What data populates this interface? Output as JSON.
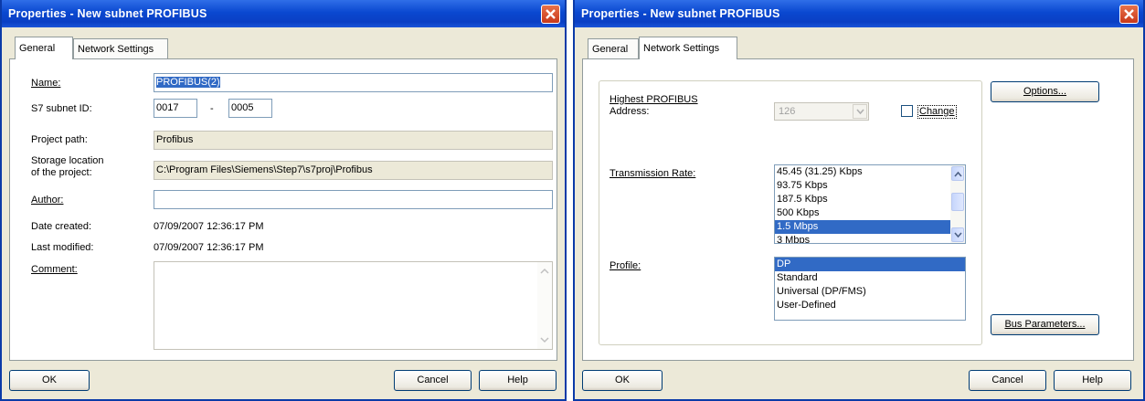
{
  "left_window": {
    "title": "Properties -  New subnet PROFIBUS",
    "tabs": [
      "General",
      "Network Settings"
    ],
    "labels": {
      "name": "Name:",
      "subnet_id": "S7 subnet ID:",
      "project_path": "Project path:",
      "storage_line1": "Storage location",
      "storage_line2": "of the project:",
      "author": "Author:",
      "date_created": "Date created:",
      "last_modified": "Last modified:",
      "comment": "Comment:"
    },
    "values": {
      "name": "PROFIBUS(2)",
      "subnet_id_part1": "0017",
      "subnet_id_sep": "-",
      "subnet_id_part2": "0005",
      "project_path": "Profibus",
      "storage_location": "C:\\Program Files\\Siemens\\Step7\\s7proj\\Profibus",
      "author": "",
      "date_created": "07/09/2007 12:36:17 PM",
      "last_modified": "07/09/2007 12:36:17 PM",
      "comment": ""
    },
    "buttons": {
      "ok": "OK",
      "cancel": "Cancel",
      "help": "Help"
    }
  },
  "right_window": {
    "title": "Properties -  New subnet PROFIBUS",
    "tabs": [
      "General",
      "Network Settings"
    ],
    "labels": {
      "highest_line1": "Highest PROFIBUS",
      "highest_line2": "Address:",
      "change": "Change",
      "transmission_rate": "Transmission Rate:",
      "profile": "Profile:"
    },
    "highest_address": "126",
    "change_checked": false,
    "transmission_rates": [
      "45.45 (31.25) Kbps",
      "93.75 Kbps",
      "187.5 Kbps",
      "500 Kbps",
      "1.5 Mbps",
      "3 Mbps"
    ],
    "selected_rate": "1.5 Mbps",
    "profiles": [
      "DP",
      "Standard",
      "Universal (DP/FMS)",
      "User-Defined"
    ],
    "selected_profile": "DP",
    "buttons": {
      "options": "Options...",
      "bus_parameters": "Bus Parameters...",
      "ok": "OK",
      "cancel": "Cancel",
      "help": "Help"
    }
  },
  "colors": {
    "titlebar": "#0a48d0",
    "selection": "#316ac5",
    "dialog_bg": "#ece9d8"
  }
}
